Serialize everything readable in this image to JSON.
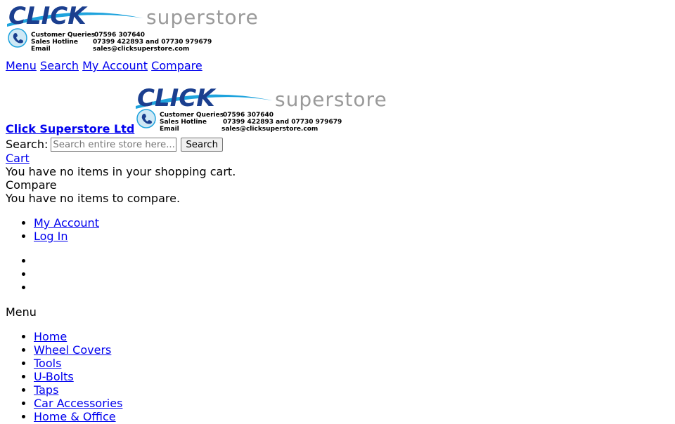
{
  "header": {
    "logo": {
      "click": "CLICK",
      "superstore": "superstore",
      "contact": [
        {
          "label": "Customer Queries",
          "value": "07596 307640"
        },
        {
          "label": "Sales Hotline",
          "value": "07399 422893 and 07730 979679"
        },
        {
          "label": "Email",
          "value": "sales@clicksuperstore.com"
        }
      ],
      "colors": {
        "click": "#1b3f8f",
        "swoosh": "#1ea3dd",
        "superstore": "#9a9a9a"
      }
    },
    "top_links": {
      "menu": "Menu",
      "search": "Search",
      "account": "My Account",
      "compare": "Compare"
    }
  },
  "branding": {
    "store_name": "Click Superstore Ltd"
  },
  "search": {
    "label": "Search:",
    "placeholder": "Search entire store here...",
    "button": "Search"
  },
  "cart": {
    "link": "Cart",
    "message": "You have no items in your shopping cart."
  },
  "compare": {
    "title": "Compare",
    "message": "You have no items to compare."
  },
  "account_links": [
    "My Account",
    "Log In"
  ],
  "menu": {
    "label": "Menu",
    "items": [
      "Home",
      "Wheel Covers",
      "Tools",
      "U-Bolts",
      "Taps",
      "Car Accessories",
      "Home & Office"
    ]
  }
}
